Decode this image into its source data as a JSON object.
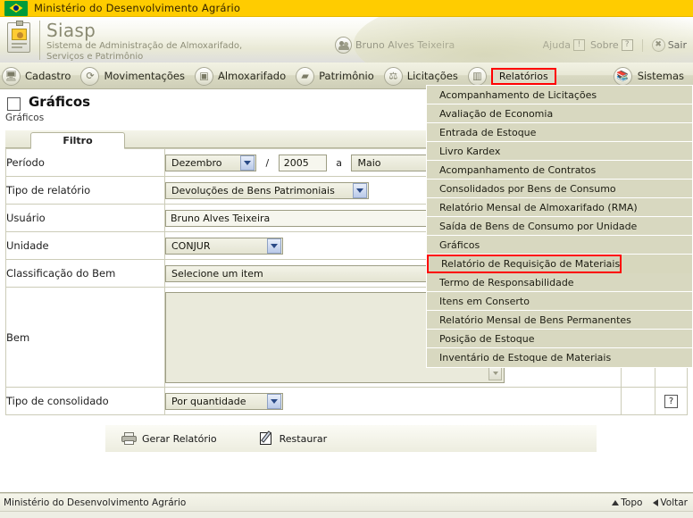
{
  "gov": {
    "title": "Ministério do Desenvolvimento Agrário",
    "flag_icon": "brazil-flag-icon"
  },
  "header": {
    "system_name": "Siasp",
    "system_subtitle_line1": "Sistema de Administração de Almoxarifado,",
    "system_subtitle_line2": "Serviços e Patrimônio",
    "badge_icon": "id-badge-icon",
    "user_icon": "users-icon",
    "user_name": "Bruno Alves Teixeira",
    "help_label": "Ajuda",
    "help_icon": "exclamation-icon",
    "about_label": "Sobre",
    "about_icon": "question-icon",
    "logout_label": "Sair",
    "logout_icon": "close-x-icon"
  },
  "nav": {
    "items": [
      {
        "label": "Cadastro",
        "icon": "monitor-icon",
        "selected": false
      },
      {
        "label": "Movimentações",
        "icon": "arrows-cycle-icon",
        "selected": false
      },
      {
        "label": "Almoxarifado",
        "icon": "boxes-icon",
        "selected": false
      },
      {
        "label": "Patrimônio",
        "icon": "tag-icon",
        "selected": false
      },
      {
        "label": "Licitações",
        "icon": "gavel-icon",
        "selected": false
      },
      {
        "label": "Relatórios",
        "icon": "bar-chart-icon",
        "selected": true
      }
    ],
    "right_item": {
      "label": "Sistemas",
      "icon": "books-icon"
    }
  },
  "menu": {
    "items": [
      {
        "label": "Acompanhamento de Licitações",
        "selected": false
      },
      {
        "label": "Avaliação de Economia",
        "selected": false
      },
      {
        "label": "Entrada de Estoque",
        "selected": false
      },
      {
        "label": "Livro Kardex",
        "selected": false
      },
      {
        "label": "Acompanhamento de Contratos",
        "selected": false
      },
      {
        "label": "Consolidados por Bens de Consumo",
        "selected": false
      },
      {
        "label": "Relatório Mensal de Almoxarifado (RMA)",
        "selected": false
      },
      {
        "label": "Saída de Bens de Consumo por Unidade",
        "selected": false
      },
      {
        "label": "Gráficos",
        "selected": false
      },
      {
        "label": "Relatório de Requisição de Materiais",
        "selected": true
      },
      {
        "label": "Termo de Responsabilidade",
        "selected": false
      },
      {
        "label": "Itens em Conserto",
        "selected": false
      },
      {
        "label": "Relatório Mensal de Bens Permanentes",
        "selected": false
      },
      {
        "label": "Posição de Estoque",
        "selected": false
      },
      {
        "label": "Inventário de Estoque de Materiais",
        "selected": false
      }
    ]
  },
  "page": {
    "help_icon": "question-icon",
    "title": "Gráficos",
    "breadcrumb": "Gráficos"
  },
  "filter": {
    "tab_label": "Filtro",
    "rows": {
      "periodo": {
        "label": "Período",
        "month_from": "Dezembro",
        "separator": "/",
        "year_from": "2005",
        "between": "a",
        "month_to": "Maio"
      },
      "tipo_relatorio": {
        "label": "Tipo de relatório",
        "value": "Devoluções de Bens Patrimoniais"
      },
      "usuario": {
        "label": "Usuário",
        "value": "Bruno Alves Teixeira"
      },
      "unidade": {
        "label": "Unidade",
        "value": "CONJUR"
      },
      "classificacao": {
        "label": "Classificação do Bem",
        "value": "Selecione um item"
      },
      "bem": {
        "label": "Bem",
        "value": ""
      },
      "tipo_consolidado": {
        "label": "Tipo de consolidado",
        "value": "Por quantidade",
        "help_icon": "question-icon"
      }
    }
  },
  "actions": {
    "generate_label": "Gerar Relatório",
    "generate_icon": "printer-icon",
    "restore_label": "Restaurar",
    "restore_icon": "edit-note-icon"
  },
  "footer": {
    "text": "Ministério do Desenvolvimento Agrário",
    "top_label": "Topo",
    "top_icon": "triangle-up-icon",
    "back_label": "Voltar",
    "back_icon": "triangle-left-icon"
  },
  "colors": {
    "gov_bar": "#ffcc00",
    "menu_bg": "#d8d8c0",
    "selection_outline": "#ff0000",
    "nav_bg": "#dcdcc8"
  }
}
